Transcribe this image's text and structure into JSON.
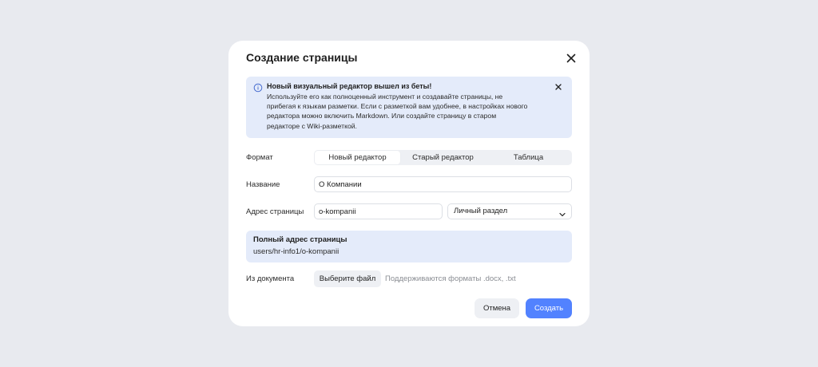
{
  "dialog": {
    "title": "Создание страницы"
  },
  "banner": {
    "title": "Новый визуальный редактор вышел из беты!",
    "text": "Используйте его как полноценный инструмент и создавайте страницы, не\nприбегая к языкам разметки. Если с разметкой вам удобнее, в настройках нового\nредактора можно включить Markdown. Или создайте страницу в старом\nредакторе с Wiki-разметкой."
  },
  "format": {
    "label": "Формат",
    "options": [
      "Новый редактор",
      "Старый редактор",
      "Таблица"
    ],
    "selected": "Новый редактор"
  },
  "name": {
    "label": "Название",
    "value": "О Компании"
  },
  "address": {
    "label": "Адрес страницы",
    "slug": "o-kompanii",
    "section": "Личный раздел"
  },
  "full_address": {
    "label": "Полный адрес страницы",
    "value": "users/hr-info1/o-kompanii"
  },
  "from_document": {
    "label": "Из документа",
    "button": "Выберите файл",
    "hint": "Поддерживаются форматы .docx, .txt"
  },
  "actions": {
    "cancel": "Отмена",
    "create": "Создать"
  },
  "colors": {
    "background": "#e8eaef",
    "info_panel": "#e4ebfa",
    "primary": "#5282ff"
  }
}
